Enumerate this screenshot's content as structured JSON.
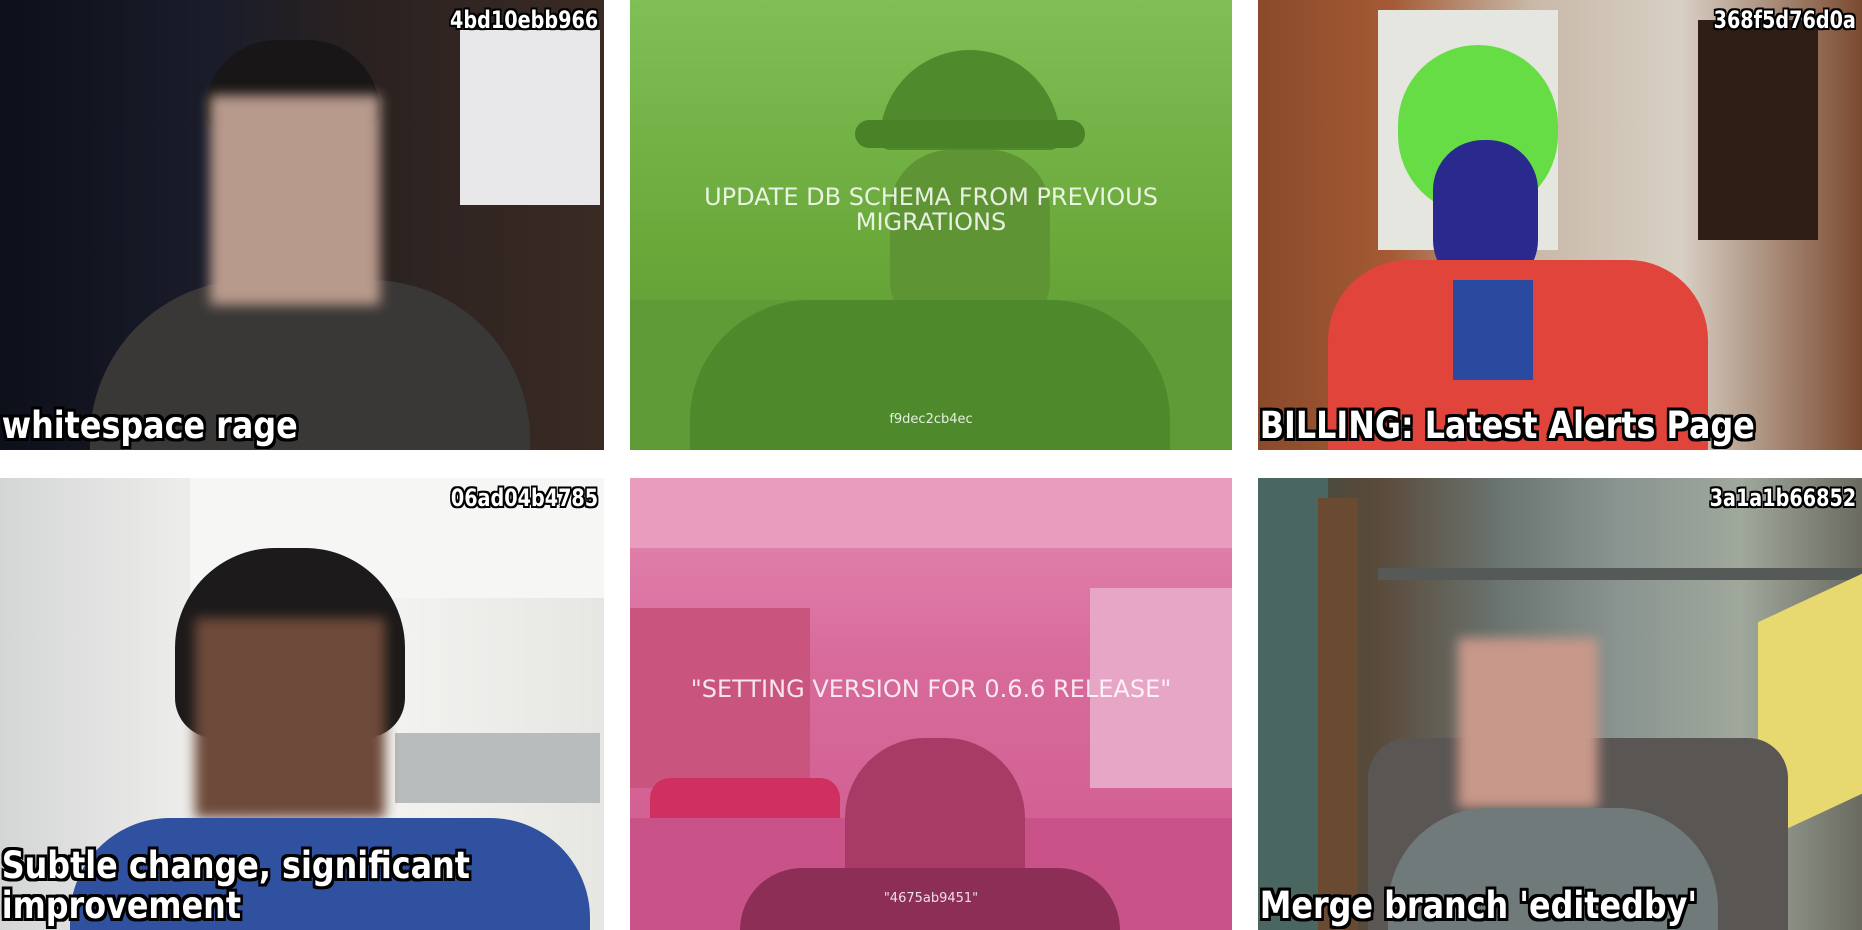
{
  "tiles": [
    {
      "hash": "4bd10ebb966",
      "caption": "whitespace rage"
    },
    {
      "overlay_title": "UPDATE DB SCHEMA FROM PREVIOUS MIGRATIONS",
      "overlay_hash": "f9dec2cb4ec",
      "tint": "#6aa83a"
    },
    {
      "hash": "368f5d76d0a",
      "caption": "BILLING: Latest Alerts Page"
    },
    {
      "hash": "06ad04b4785",
      "caption": "Subtle change, significant\nimprovement"
    },
    {
      "overlay_title": "\"SETTING VERSION FOR 0.6.6 RELEASE\"",
      "overlay_hash": "\"4675ab9451\"",
      "tint": "#d64a86"
    },
    {
      "hash": "3a1a1b66852",
      "caption": "Merge branch 'editedby'"
    }
  ]
}
